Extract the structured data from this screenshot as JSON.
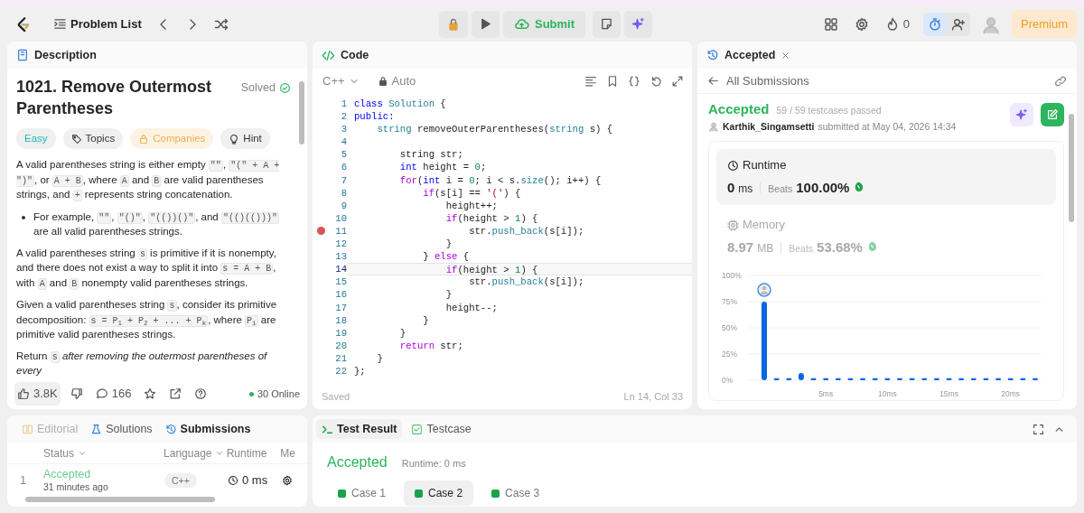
{
  "topbar": {
    "problem_list": "Problem List",
    "submit": "Submit",
    "streak": "0",
    "premium": "Premium"
  },
  "description": {
    "tab": "Description",
    "title": "1021. Remove Outermost Parentheses",
    "status": "Solved",
    "tags": [
      {
        "label": "Easy",
        "kind": "difficulty"
      },
      {
        "label": "Topics",
        "kind": "topics"
      },
      {
        "label": "Companies",
        "kind": "companies"
      },
      {
        "label": "Hint",
        "kind": "hint"
      }
    ],
    "paragraphs": [
      {
        "kind": "text",
        "segments": [
          {
            "kind": "text",
            "text": "A valid parentheses string is either empty "
          },
          {
            "kind": "code",
            "text": "\"\""
          },
          {
            "kind": "text",
            "text": ", "
          },
          {
            "kind": "code",
            "text": "\"(\" + A + \")\""
          },
          {
            "kind": "text",
            "text": ", or "
          },
          {
            "kind": "code",
            "text": "A + B"
          },
          {
            "kind": "text",
            "text": ", where "
          },
          {
            "kind": "code",
            "text": "A"
          },
          {
            "kind": "text",
            "text": " and "
          },
          {
            "kind": "code",
            "text": "B"
          },
          {
            "kind": "text",
            "text": " are valid parentheses strings, and "
          },
          {
            "kind": "code",
            "text": "+"
          },
          {
            "kind": "text",
            "text": " represents string concatenation."
          }
        ]
      },
      {
        "kind": "bullet",
        "segments": [
          {
            "kind": "text",
            "text": "For example, "
          },
          {
            "kind": "code",
            "text": "\"\""
          },
          {
            "kind": "text",
            "text": ", "
          },
          {
            "kind": "code",
            "text": "\"()\""
          },
          {
            "kind": "text",
            "text": ", "
          },
          {
            "kind": "code",
            "text": "\"(())()\""
          },
          {
            "kind": "text",
            "text": ", and "
          },
          {
            "kind": "code",
            "text": "\"(()(()))\""
          },
          {
            "kind": "text",
            "text": " are all valid parentheses strings."
          }
        ]
      },
      {
        "kind": "text",
        "segments": [
          {
            "kind": "text",
            "text": "A valid parentheses string "
          },
          {
            "kind": "code",
            "text": "s"
          },
          {
            "kind": "text",
            "text": " is primitive if it is nonempty, and there does not exist a way to split it into "
          },
          {
            "kind": "code",
            "text": "s = A + B"
          },
          {
            "kind": "text",
            "text": ", with "
          },
          {
            "kind": "code",
            "text": "A"
          },
          {
            "kind": "text",
            "text": " and "
          },
          {
            "kind": "code",
            "text": "B"
          },
          {
            "kind": "text",
            "text": " nonempty valid parentheses strings."
          }
        ]
      },
      {
        "kind": "text",
        "segments": [
          {
            "kind": "text",
            "text": "Given a valid parentheses string "
          },
          {
            "kind": "code",
            "text": "s"
          },
          {
            "kind": "text",
            "text": ", consider its primitive decomposition: "
          },
          {
            "kind": "code",
            "text": "s = P$_{1}$ + P$_{2}$ + ... + P$_{k}$"
          },
          {
            "kind": "text",
            "text": ", where "
          },
          {
            "kind": "code",
            "text": "P$_{i}$"
          },
          {
            "kind": "text",
            "text": " are primitive valid parentheses strings."
          }
        ]
      },
      {
        "kind": "text",
        "segments": [
          {
            "kind": "text",
            "text": "Return "
          },
          {
            "kind": "code",
            "text": "s"
          },
          {
            "kind": "text",
            "text": " *after removing the outermost parentheses of every*"
          }
        ]
      }
    ],
    "likes": "3.8K",
    "comments": "166",
    "online": "30 Online"
  },
  "code": {
    "tab": "Code",
    "language": "C++",
    "mode": "Auto",
    "saved": "Saved",
    "cursor": "Ln 14, Col 33",
    "lines": [
      {
        "n": "1",
        "breakpoint": false,
        "current": false,
        "segs": [
          {
            "kind": "kw",
            "text": "class"
          },
          {
            "kind": "type",
            "text": " Solution"
          },
          {
            "kind": "plain",
            "text": " {"
          }
        ]
      },
      {
        "n": "2",
        "breakpoint": false,
        "current": false,
        "segs": [
          {
            "kind": "kw",
            "text": "public:"
          }
        ]
      },
      {
        "n": "3",
        "breakpoint": false,
        "current": false,
        "segs": [
          {
            "kind": "type",
            "text": "    string"
          },
          {
            "kind": "plain",
            "text": " removeOuterParentheses("
          },
          {
            "kind": "type",
            "text": "string"
          },
          {
            "kind": "plain",
            "text": " s) {"
          }
        ]
      },
      {
        "n": "4",
        "breakpoint": false,
        "current": false
      },
      {
        "n": "5",
        "breakpoint": false,
        "current": false,
        "segs": [
          {
            "kind": "plain",
            "text": "        string str;"
          }
        ]
      },
      {
        "n": "6",
        "breakpoint": false,
        "current": false,
        "segs": [
          {
            "kind": "kw",
            "text": "        int"
          },
          {
            "kind": "plain",
            "text": " height = "
          },
          {
            "kind": "num",
            "text": "0"
          },
          {
            "kind": "plain",
            "text": ";"
          }
        ]
      },
      {
        "n": "7",
        "breakpoint": false,
        "current": false,
        "segs": [
          {
            "kind": "ctl",
            "text": "        for"
          },
          {
            "kind": "plain",
            "text": "("
          },
          {
            "kind": "kw",
            "text": "int"
          },
          {
            "kind": "plain",
            "text": " i = "
          },
          {
            "kind": "num",
            "text": "0"
          },
          {
            "kind": "plain",
            "text": "; i < s."
          },
          {
            "kind": "fn",
            "text": "size"
          },
          {
            "kind": "plain",
            "text": "(); i++) {"
          }
        ]
      },
      {
        "n": "8",
        "breakpoint": false,
        "current": false,
        "segs": [
          {
            "kind": "ctl",
            "text": "            if"
          },
          {
            "kind": "plain",
            "text": "(s[i] == "
          },
          {
            "kind": "str",
            "text": "'('"
          },
          {
            "kind": "plain",
            "text": ") {"
          }
        ]
      },
      {
        "n": "9",
        "breakpoint": false,
        "current": false,
        "segs": [
          {
            "kind": "plain",
            "text": "                height++;"
          }
        ]
      },
      {
        "n": "10",
        "breakpoint": false,
        "current": false,
        "segs": [
          {
            "kind": "ctl",
            "text": "                if"
          },
          {
            "kind": "plain",
            "text": "(height > "
          },
          {
            "kind": "num",
            "text": "1"
          },
          {
            "kind": "plain",
            "text": ") {"
          }
        ]
      },
      {
        "n": "11",
        "breakpoint": true,
        "current": false,
        "segs": [
          {
            "kind": "plain",
            "text": "                    str."
          },
          {
            "kind": "fn",
            "text": "push_back"
          },
          {
            "kind": "plain",
            "text": "(s[i]);"
          }
        ]
      },
      {
        "n": "12",
        "breakpoint": false,
        "current": false,
        "segs": [
          {
            "kind": "plain",
            "text": "                }"
          }
        ]
      },
      {
        "n": "13",
        "breakpoint": false,
        "current": false,
        "segs": [
          {
            "kind": "plain",
            "text": "            } "
          },
          {
            "kind": "ctl",
            "text": "else"
          },
          {
            "kind": "plain",
            "text": " {"
          }
        ]
      },
      {
        "n": "14",
        "breakpoint": false,
        "current": true,
        "segs": [
          {
            "kind": "ctl",
            "text": "                if"
          },
          {
            "kind": "plain",
            "text": "(height > "
          },
          {
            "kind": "num",
            "text": "1"
          },
          {
            "kind": "plain",
            "text": ") {"
          }
        ]
      },
      {
        "n": "15",
        "breakpoint": false,
        "current": false,
        "segs": [
          {
            "kind": "plain",
            "text": "                    str."
          },
          {
            "kind": "fn",
            "text": "push_back"
          },
          {
            "kind": "plain",
            "text": "(s[i]);"
          }
        ]
      },
      {
        "n": "16",
        "breakpoint": false,
        "current": false,
        "segs": [
          {
            "kind": "plain",
            "text": "                }"
          }
        ]
      },
      {
        "n": "17",
        "breakpoint": false,
        "current": false,
        "segs": [
          {
            "kind": "plain",
            "text": "                height--;"
          }
        ]
      },
      {
        "n": "18",
        "breakpoint": false,
        "current": false,
        "segs": [
          {
            "kind": "plain",
            "text": "            }"
          }
        ]
      },
      {
        "n": "19",
        "breakpoint": false,
        "current": false,
        "segs": [
          {
            "kind": "plain",
            "text": "        }"
          }
        ]
      },
      {
        "n": "20",
        "breakpoint": false,
        "current": false,
        "segs": [
          {
            "kind": "ctl",
            "text": "        return"
          },
          {
            "kind": "plain",
            "text": " str;"
          }
        ]
      },
      {
        "n": "21",
        "breakpoint": false,
        "current": false,
        "segs": [
          {
            "kind": "plain",
            "text": "    }"
          }
        ]
      },
      {
        "n": "22",
        "breakpoint": false,
        "current": false,
        "segs": [
          {
            "kind": "plain",
            "text": "};"
          }
        ]
      }
    ]
  },
  "submission": {
    "tab": "Accepted",
    "back": "All Submissions",
    "verdict": "Accepted",
    "testcases": "59 / 59 testcases passed",
    "user": "Karthik_Singamsetti",
    "submitted": "submitted at May 04, 2026 14:34",
    "metrics": [
      {
        "kind": "runtime",
        "label": "Runtime",
        "value": "0",
        "unit": "ms",
        "beats_label": "Beats",
        "beats": "100.00%",
        "selected": true
      },
      {
        "kind": "memory",
        "label": "Memory",
        "value": "8.97",
        "unit": "MB",
        "beats_label": "Beats",
        "beats": "53.68%",
        "selected": false
      }
    ],
    "chart_data": {
      "type": "bar",
      "x": [
        0,
        1,
        2,
        3,
        4,
        5,
        6,
        7,
        8,
        9,
        10,
        11,
        12,
        13,
        14,
        15,
        16,
        17,
        18,
        19,
        20,
        21,
        22
      ],
      "values": [
        75,
        2,
        2,
        7,
        2,
        2,
        2,
        2,
        2,
        2,
        2,
        2,
        2,
        2,
        2,
        2,
        2,
        2,
        2,
        2,
        2,
        2,
        2
      ],
      "grid": true,
      "xlim": [
        0,
        22
      ],
      "ylim": [
        0,
        100
      ],
      "yticks": [
        {
          "value": 0,
          "label": "0%"
        },
        {
          "value": 25,
          "label": "25%"
        },
        {
          "value": 50,
          "label": "50%"
        },
        {
          "value": 75,
          "label": "75%"
        },
        {
          "value": 100,
          "label": "100%"
        }
      ],
      "xticks": [
        {
          "value": 5,
          "label": "5ms"
        },
        {
          "value": 10,
          "label": "10ms"
        },
        {
          "value": 15,
          "label": "15ms"
        },
        {
          "value": 20,
          "label": "20ms"
        }
      ]
    }
  },
  "submissions_panel": {
    "tabs": [
      {
        "label": "Editorial",
        "kind": "editorial",
        "selected": false,
        "disabled": true
      },
      {
        "label": "Solutions",
        "kind": "solutions",
        "selected": false,
        "disabled": false
      },
      {
        "label": "Submissions",
        "kind": "submissions",
        "selected": true,
        "disabled": false
      }
    ],
    "columns": [
      {
        "label": "Status",
        "filter": true
      },
      {
        "label": "Language",
        "filter": true
      },
      {
        "label": "Runtime",
        "filter": false
      },
      {
        "label": "Me",
        "filter": false
      }
    ],
    "rows": [
      {
        "index": "1",
        "status": "Accepted",
        "time": "31 minutes ago",
        "language": "C++",
        "runtime": "0 ms"
      }
    ]
  },
  "test_result": {
    "tabs": [
      {
        "label": "Test Result",
        "kind": "result",
        "selected": true
      },
      {
        "label": "Testcase",
        "kind": "testcase",
        "selected": false
      }
    ],
    "verdict": "Accepted",
    "runtime": "Runtime: 0 ms",
    "cases": [
      {
        "label": "Case 1",
        "passed": true,
        "selected": false
      },
      {
        "label": "Case 2",
        "passed": true,
        "selected": true
      },
      {
        "label": "Case 3",
        "passed": true,
        "selected": false
      }
    ]
  }
}
